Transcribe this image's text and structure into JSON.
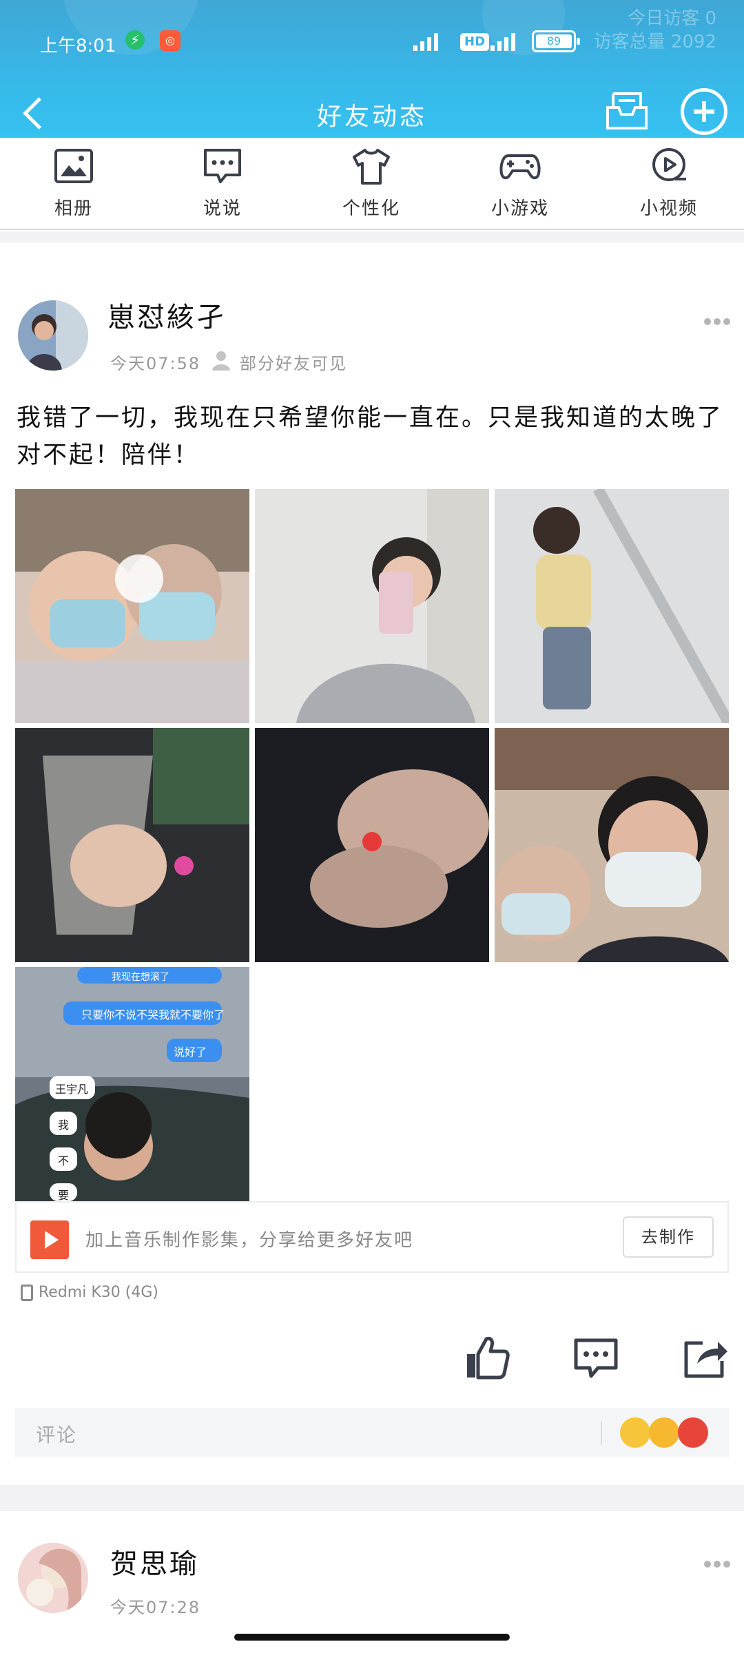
{
  "status_bar": {
    "time": "上午8:01",
    "hd": "HD",
    "battery": "89"
  },
  "header": {
    "title": "好友动态",
    "bg_overlay_lines": [
      "今日访客    0",
      "访客总量  2092"
    ]
  },
  "categories": [
    {
      "label": "相册",
      "icon": "album-icon"
    },
    {
      "label": "说说",
      "icon": "chat-bubble-icon"
    },
    {
      "label": "个性化",
      "icon": "tshirt-icon"
    },
    {
      "label": "小游戏",
      "icon": "gamepad-icon"
    },
    {
      "label": "小视频",
      "icon": "video-play-icon"
    }
  ],
  "post1": {
    "author": "崽怼絯孑",
    "time": "今天07:58",
    "visibility": "部分好友可见",
    "text": "我错了一切，我现在只希望你能一直在。只是我知道的太晚了 对不起！陪伴！",
    "screenshot_chat": [
      "我现在想滚了",
      "只要你不说不哭我就不要你了",
      "说好了",
      "王宇凡",
      "我",
      "不",
      "要"
    ],
    "music_prompt": "加上音乐制作影集，分享给更多好友吧",
    "music_button": "去制作",
    "device": "Redmi K30 (4G)",
    "comment_placeholder": "评论"
  },
  "post2": {
    "author": "贺思瑜",
    "time": "今天07:28"
  },
  "colors": {
    "header_top": "#3fa7d6",
    "header_bottom": "#34c6f3",
    "icon_stroke": "#3a3f4b",
    "music_red": "#f05a3b"
  }
}
